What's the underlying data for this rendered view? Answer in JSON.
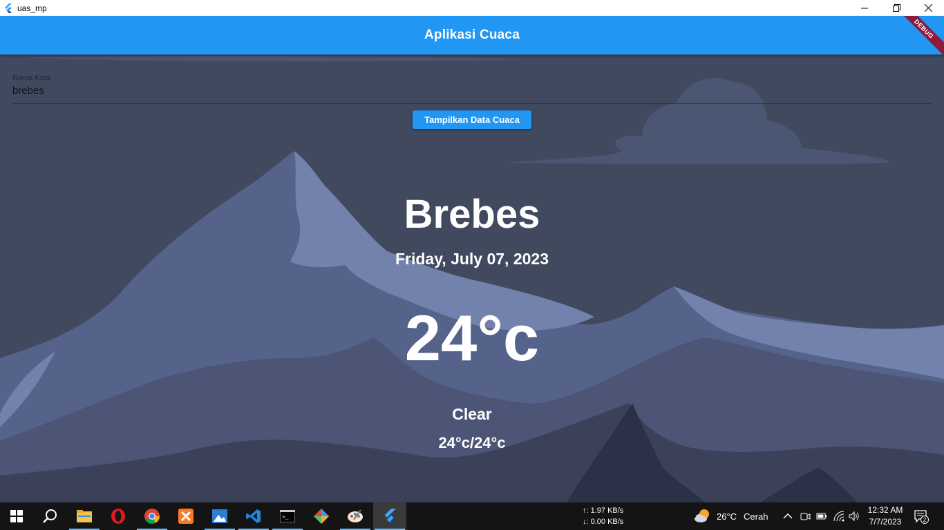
{
  "window": {
    "title": "uas_mp",
    "icon": "flutter-icon"
  },
  "appbar": {
    "title": "Aplikasi Cuaca",
    "debug_banner": "DEBUG",
    "color": "#2196f3"
  },
  "form": {
    "city_label": "Nama Kota",
    "city_value": "brebes",
    "button_label": "Tampilkan Data Cuaca"
  },
  "weather": {
    "city": "Brebes",
    "date": "Friday, July 07, 2023",
    "temperature": "24°c",
    "condition": "Clear",
    "min_max": "24°c/24°c"
  },
  "taskbar": {
    "apps": [
      "start-icon",
      "search-icon",
      "file-explorer-icon",
      "opera-icon",
      "chrome-icon",
      "xampp-icon",
      "photos-icon",
      "vscode-icon",
      "terminal-icon",
      "git-icon",
      "paint-icon",
      "flutter-icon"
    ],
    "net_up": "↑: 1.97 KB/s",
    "net_down": "↓: 0.00 KB/s",
    "weather_temp": "26°C",
    "weather_text": "Cerah",
    "time": "12:32 AM",
    "date": "7/7/2023",
    "notifications": "2"
  }
}
